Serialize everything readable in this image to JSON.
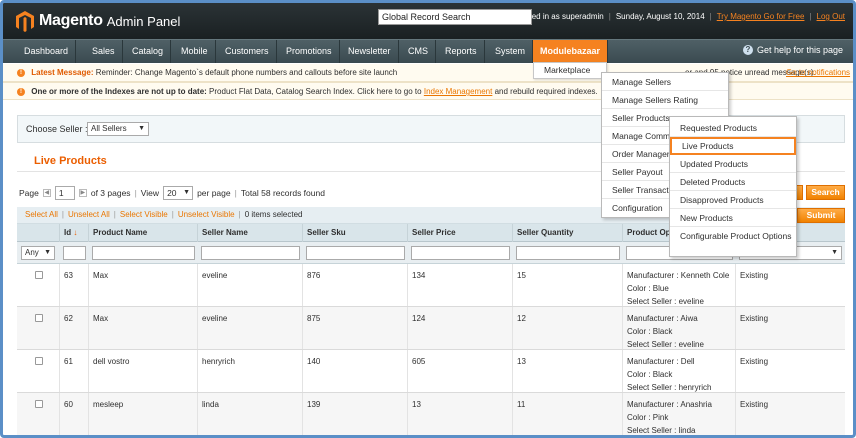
{
  "header": {
    "logo_text": "Magento",
    "logo_sub": "Admin Panel",
    "search_value": "Global Record Search",
    "logged_in": "Logged in as superadmin",
    "date": "Sunday, August 10, 2014",
    "try_link": "Try Magento Go for Free",
    "logout": "Log Out"
  },
  "nav": {
    "items": [
      "Dashboard",
      "Sales",
      "Catalog",
      "Mobile",
      "Customers",
      "Promotions",
      "Newsletter",
      "CMS",
      "Reports",
      "System",
      "Modulebazaar"
    ],
    "help": "Get help for this page"
  },
  "messages": {
    "latest_label": "Latest Message:",
    "latest_text": "Reminder: Change Magento`s default phone numbers and callouts before site launch",
    "latest_tail": "or and 95 notice unread message(s).",
    "goto_link": "Go to notifications",
    "index_bold": "One or more of the Indexes are not up to date:",
    "index_text": "Product Flat Data, Catalog Search Index. Click here to go to",
    "index_link": "Index Management",
    "index_tail": "and rebuild required indexes."
  },
  "seller_filter": {
    "label": "Choose Seller :",
    "value": "All Sellers"
  },
  "page_title": "Live Products",
  "pager": {
    "page_label": "Page",
    "page_value": "1",
    "of_pages": "of 3 pages",
    "view_label": "View",
    "per_page_value": "20",
    "per_page_label": "per page",
    "total": "Total 58 records found"
  },
  "buttons": {
    "search": "Search",
    "submit": "Submit"
  },
  "mass_action": {
    "select_all": "Select All",
    "unselect_all": "Unselect All",
    "select_visible": "Select Visible",
    "unselect_visible": "Unselect Visible",
    "selected": "0 items selected"
  },
  "grid": {
    "columns": [
      "",
      "Id",
      "Product Name",
      "Seller Name",
      "Seller Sku",
      "Seller Price",
      "Seller Quantity",
      "Product Op",
      ""
    ],
    "any_filter": "Any",
    "rows": [
      {
        "id": "63",
        "name": "Max",
        "seller": "eveline",
        "sku": "876",
        "price": "134",
        "qty": "15",
        "opt1": "Manufacturer : Kenneth Cole",
        "opt2": "Color : Blue",
        "opt3": "Select Seller : eveline",
        "status": "Existing"
      },
      {
        "id": "62",
        "name": "Max",
        "seller": "eveline",
        "sku": "875",
        "price": "124",
        "qty": "12",
        "opt1": "Manufacturer : Aiwa",
        "opt2": "Color : Black",
        "opt3": "Select Seller : eveline",
        "status": "Existing"
      },
      {
        "id": "61",
        "name": "dell vostro",
        "seller": "henryrich",
        "sku": "140",
        "price": "605",
        "qty": "13",
        "opt1": "Manufacturer : Dell",
        "opt2": "Color : Black",
        "opt3": "Select Seller : henryrich",
        "status": "Existing"
      },
      {
        "id": "60",
        "name": "mesleep",
        "seller": "linda",
        "sku": "139",
        "price": "13",
        "qty": "11",
        "opt1": "Manufacturer : Anashria",
        "opt2": "Color : Pink",
        "opt3": "Select Seller : linda",
        "status": "Existing"
      }
    ]
  },
  "menus": {
    "level1": "Marketplace",
    "level2": [
      "Manage Sellers",
      "Manage Sellers Rating",
      "Seller Products",
      "Manage Comm",
      "Order Managen",
      "Seller Payout",
      "Seller Transacti",
      "Configuration"
    ],
    "level3": [
      "Requested Products",
      "Live Products",
      "Updated Products",
      "Deleted Products",
      "Disapproved Products",
      "New Products",
      "Configurable Product Options"
    ]
  },
  "colors": {
    "accent": "#f58220",
    "header_bg": "#2b3336",
    "nav_bg": "#4f6066",
    "title": "#eb5e00"
  }
}
